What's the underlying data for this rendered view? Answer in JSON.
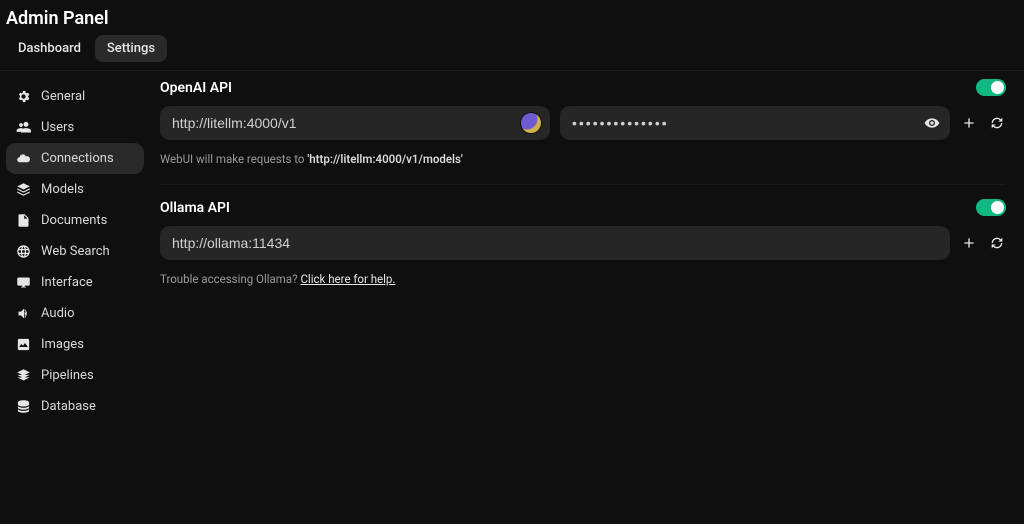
{
  "header": {
    "title": "Admin Panel",
    "tabs": [
      {
        "label": "Dashboard",
        "active": false
      },
      {
        "label": "Settings",
        "active": true
      }
    ]
  },
  "sidebar": {
    "items": [
      {
        "icon": "gear",
        "label": "General"
      },
      {
        "icon": "users",
        "label": "Users"
      },
      {
        "icon": "cloud",
        "label": "Connections",
        "active": true
      },
      {
        "icon": "stack",
        "label": "Models"
      },
      {
        "icon": "doc",
        "label": "Documents"
      },
      {
        "icon": "globe",
        "label": "Web Search"
      },
      {
        "icon": "monitor",
        "label": "Interface"
      },
      {
        "icon": "audio",
        "label": "Audio"
      },
      {
        "icon": "image",
        "label": "Images"
      },
      {
        "icon": "layers",
        "label": "Pipelines"
      },
      {
        "icon": "db",
        "label": "Database"
      }
    ]
  },
  "openai": {
    "title": "OpenAI API",
    "enabled": true,
    "url_value": "http://litellm:4000/v1",
    "key_value": "••••••••••••••",
    "hint_prefix": "WebUI will make requests to ",
    "hint_bold": "'http://litellm:4000/v1/models'"
  },
  "ollama": {
    "title": "Ollama API",
    "enabled": true,
    "url_value": "http://ollama:11434",
    "help_prefix": "Trouble accessing Ollama? ",
    "help_link": "Click here for help."
  }
}
